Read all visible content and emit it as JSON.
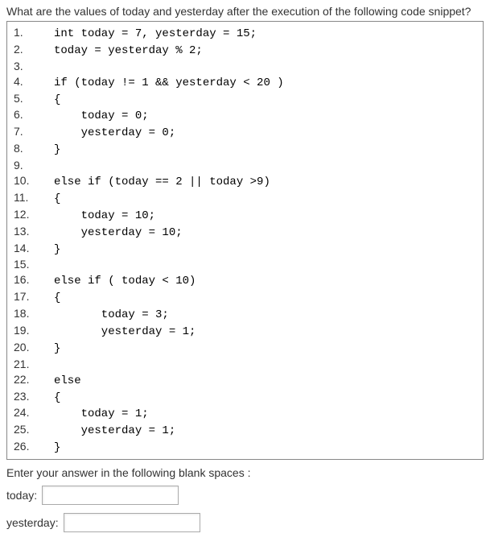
{
  "question": "What are the values of today and yesterday after the execution of the following code snippet?",
  "code": {
    "lines": [
      {
        "n": "1.",
        "t": "int today = 7, yesterday = 15;"
      },
      {
        "n": "2.",
        "t": "today = yesterday % 2;"
      },
      {
        "n": "3.",
        "t": ""
      },
      {
        "n": "4.",
        "t": "if (today != 1 && yesterday < 20 )"
      },
      {
        "n": "5.",
        "t": "{"
      },
      {
        "n": "6.",
        "t": "    today = 0;"
      },
      {
        "n": "7.",
        "t": "    yesterday = 0;"
      },
      {
        "n": "8.",
        "t": "}"
      },
      {
        "n": "9.",
        "t": ""
      },
      {
        "n": "10.",
        "t": "else if (today == 2 || today >9)"
      },
      {
        "n": "11.",
        "t": "{"
      },
      {
        "n": "12.",
        "t": "    today = 10;"
      },
      {
        "n": "13.",
        "t": "    yesterday = 10;"
      },
      {
        "n": "14.",
        "t": "}"
      },
      {
        "n": "15.",
        "t": ""
      },
      {
        "n": "16.",
        "t": "else if ( today < 10)"
      },
      {
        "n": "17.",
        "t": "{"
      },
      {
        "n": "18.",
        "t": "       today = 3;"
      },
      {
        "n": "19.",
        "t": "       yesterday = 1;"
      },
      {
        "n": "20.",
        "t": "}"
      },
      {
        "n": "21.",
        "t": ""
      },
      {
        "n": "22.",
        "t": "else"
      },
      {
        "n": "23.",
        "t": "{"
      },
      {
        "n": "24.",
        "t": "    today = 1;"
      },
      {
        "n": "25.",
        "t": "    yesterday = 1;"
      },
      {
        "n": "26.",
        "t": "}"
      }
    ]
  },
  "answer_prompt": "Enter your answer in the following blank spaces :",
  "labels": {
    "today": "today:",
    "yesterday": "yesterday:"
  },
  "inputs": {
    "today_value": "",
    "yesterday_value": ""
  }
}
